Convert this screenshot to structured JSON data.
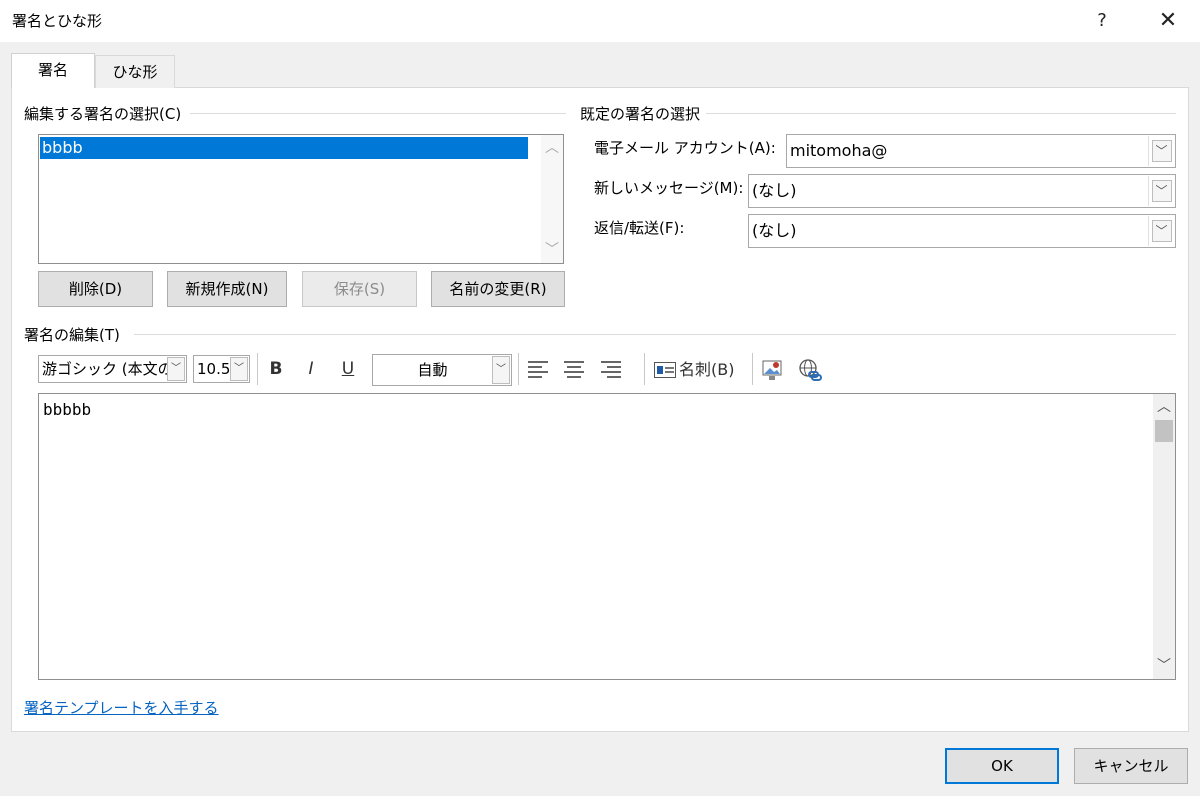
{
  "window": {
    "title": "署名とひな形",
    "help": "?",
    "close": "✕"
  },
  "tabs": [
    {
      "label": "署名"
    },
    {
      "label": "ひな形"
    }
  ],
  "edit_select": {
    "label": "編集する署名の選択(C)",
    "items": [
      "bbbb"
    ]
  },
  "list_buttons": {
    "delete": "削除(D)",
    "new": "新規作成(N)",
    "save": "保存(S)",
    "rename": "名前の変更(R)"
  },
  "defaults": {
    "label": "既定の署名の選択",
    "account_label": "電子メール アカウント(A):",
    "account_value": "mitomoha@",
    "new_msg_label": "新しいメッセージ(M):",
    "new_msg_value": "(なし)",
    "reply_label": "返信/転送(F):",
    "reply_value": "(なし)"
  },
  "editor": {
    "label": "署名の編集(T)",
    "font": "游ゴシック (本文の",
    "size": "10.5",
    "bold": "B",
    "italic": "I",
    "underline": "U",
    "color": "自動",
    "business_card": "名刺(B)",
    "content": "bbbbb"
  },
  "template_link": "署名テンプレートを入手する",
  "footer": {
    "ok": "OK",
    "cancel": "キャンセル"
  },
  "icons": {
    "chevron_down": "﹀",
    "chevron_up": "︿"
  }
}
